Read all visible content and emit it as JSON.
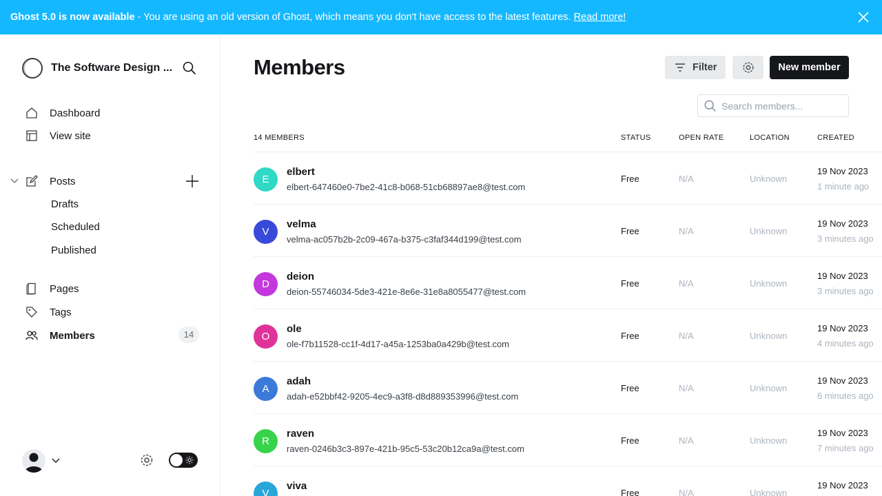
{
  "banner": {
    "strong": "Ghost 5.0 is now available",
    "text": "- You are using an old version of Ghost, which means you don't have access to the latest features.",
    "link": "Read more!"
  },
  "sidebar": {
    "site_title": "The Software Design ...",
    "nav": {
      "dashboard": "Dashboard",
      "view_site": "View site",
      "posts": "Posts",
      "drafts": "Drafts",
      "scheduled": "Scheduled",
      "published": "Published",
      "pages": "Pages",
      "tags": "Tags",
      "members": "Members",
      "members_count": "14"
    }
  },
  "main": {
    "title": "Members",
    "filter_label": "Filter",
    "new_member_label": "New member",
    "search_placeholder": "Search members...",
    "columns": {
      "count": "14 MEMBERS",
      "status": "STATUS",
      "open_rate": "OPEN RATE",
      "location": "LOCATION",
      "created": "CREATED"
    },
    "members": [
      {
        "initial": "E",
        "color": "#2fd9c6",
        "name": "elbert",
        "email": "elbert-647460e0-7be2-41c8-b068-51cb68897ae8@test.com",
        "status": "Free",
        "open_rate": "N/A",
        "location": "Unknown",
        "date": "19 Nov 2023",
        "ago": "1 minute ago"
      },
      {
        "initial": "V",
        "color": "#3949d9",
        "name": "velma",
        "email": "velma-ac057b2b-2c09-467a-b375-c3faf344d199@test.com",
        "status": "Free",
        "open_rate": "N/A",
        "location": "Unknown",
        "date": "19 Nov 2023",
        "ago": "3 minutes ago"
      },
      {
        "initial": "D",
        "color": "#c338dd",
        "name": "deion",
        "email": "deion-55746034-5de3-421e-8e6e-31e8a8055477@test.com",
        "status": "Free",
        "open_rate": "N/A",
        "location": "Unknown",
        "date": "19 Nov 2023",
        "ago": "3 minutes ago"
      },
      {
        "initial": "O",
        "color": "#e0339a",
        "name": "ole",
        "email": "ole-f7b11528-cc1f-4d17-a45a-1253ba0a429b@test.com",
        "status": "Free",
        "open_rate": "N/A",
        "location": "Unknown",
        "date": "19 Nov 2023",
        "ago": "4 minutes ago"
      },
      {
        "initial": "A",
        "color": "#3b7ad9",
        "name": "adah",
        "email": "adah-e52bbf42-9205-4ec9-a3f8-d8d889353996@test.com",
        "status": "Free",
        "open_rate": "N/A",
        "location": "Unknown",
        "date": "19 Nov 2023",
        "ago": "6 minutes ago"
      },
      {
        "initial": "R",
        "color": "#37d34a",
        "name": "raven",
        "email": "raven-0246b3c3-897e-421b-95c5-53c20b12ca9a@test.com",
        "status": "Free",
        "open_rate": "N/A",
        "location": "Unknown",
        "date": "19 Nov 2023",
        "ago": "7 minutes ago"
      },
      {
        "initial": "V",
        "color": "#2aa6d9",
        "name": "viva",
        "email": "",
        "status": "Free",
        "open_rate": "N/A",
        "location": "Unknown",
        "date": "19 Nov 2023",
        "ago": ""
      }
    ]
  }
}
